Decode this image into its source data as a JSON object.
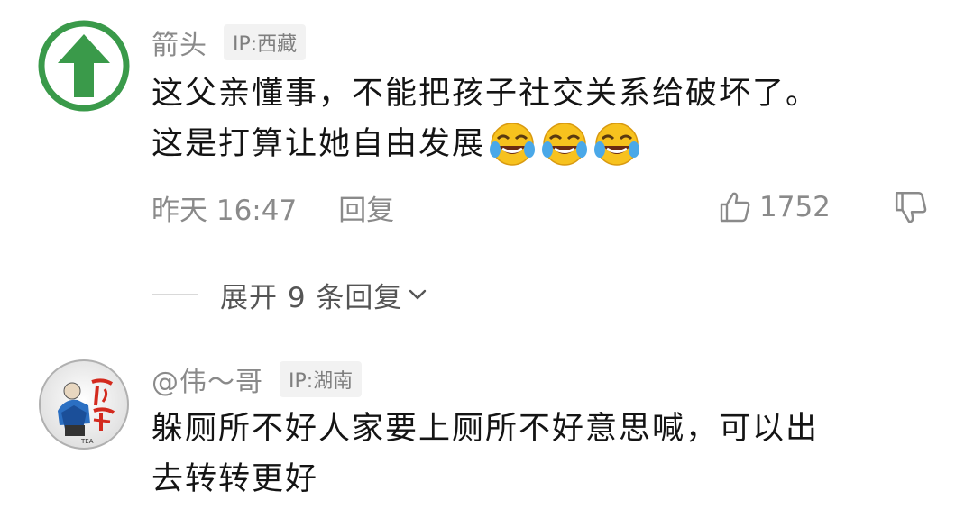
{
  "comments": [
    {
      "username": "箭头",
      "ip": "IP:西藏",
      "lines": [
        "这父亲懂事，不能把孩子社交关系给破坏了。",
        "这是打算让她自由发展"
      ],
      "emoji": "laughing-crying-emoji",
      "emoji_count": 3,
      "timestamp": "昨天 16:47",
      "reply_label": "回复",
      "likes": "1752",
      "avatar_icon": "green-up-arrow-icon",
      "avatar_color": "#3a9a4a"
    },
    {
      "username": "@伟～哥",
      "ip": "IP:湖南",
      "lines": [
        "躲厕所不好人家要上厕所不好意思喊，可以出",
        "去转转更好"
      ],
      "avatar_text": "阿伟",
      "avatar_caption": "TEA",
      "avatar_color": "#d32a1e"
    }
  ],
  "expand_replies": {
    "label": "展开 9 条回复"
  },
  "colors": {
    "meta_gray": "#8a8a8a",
    "badge_bg": "#f2f2f2",
    "text": "#141414"
  }
}
